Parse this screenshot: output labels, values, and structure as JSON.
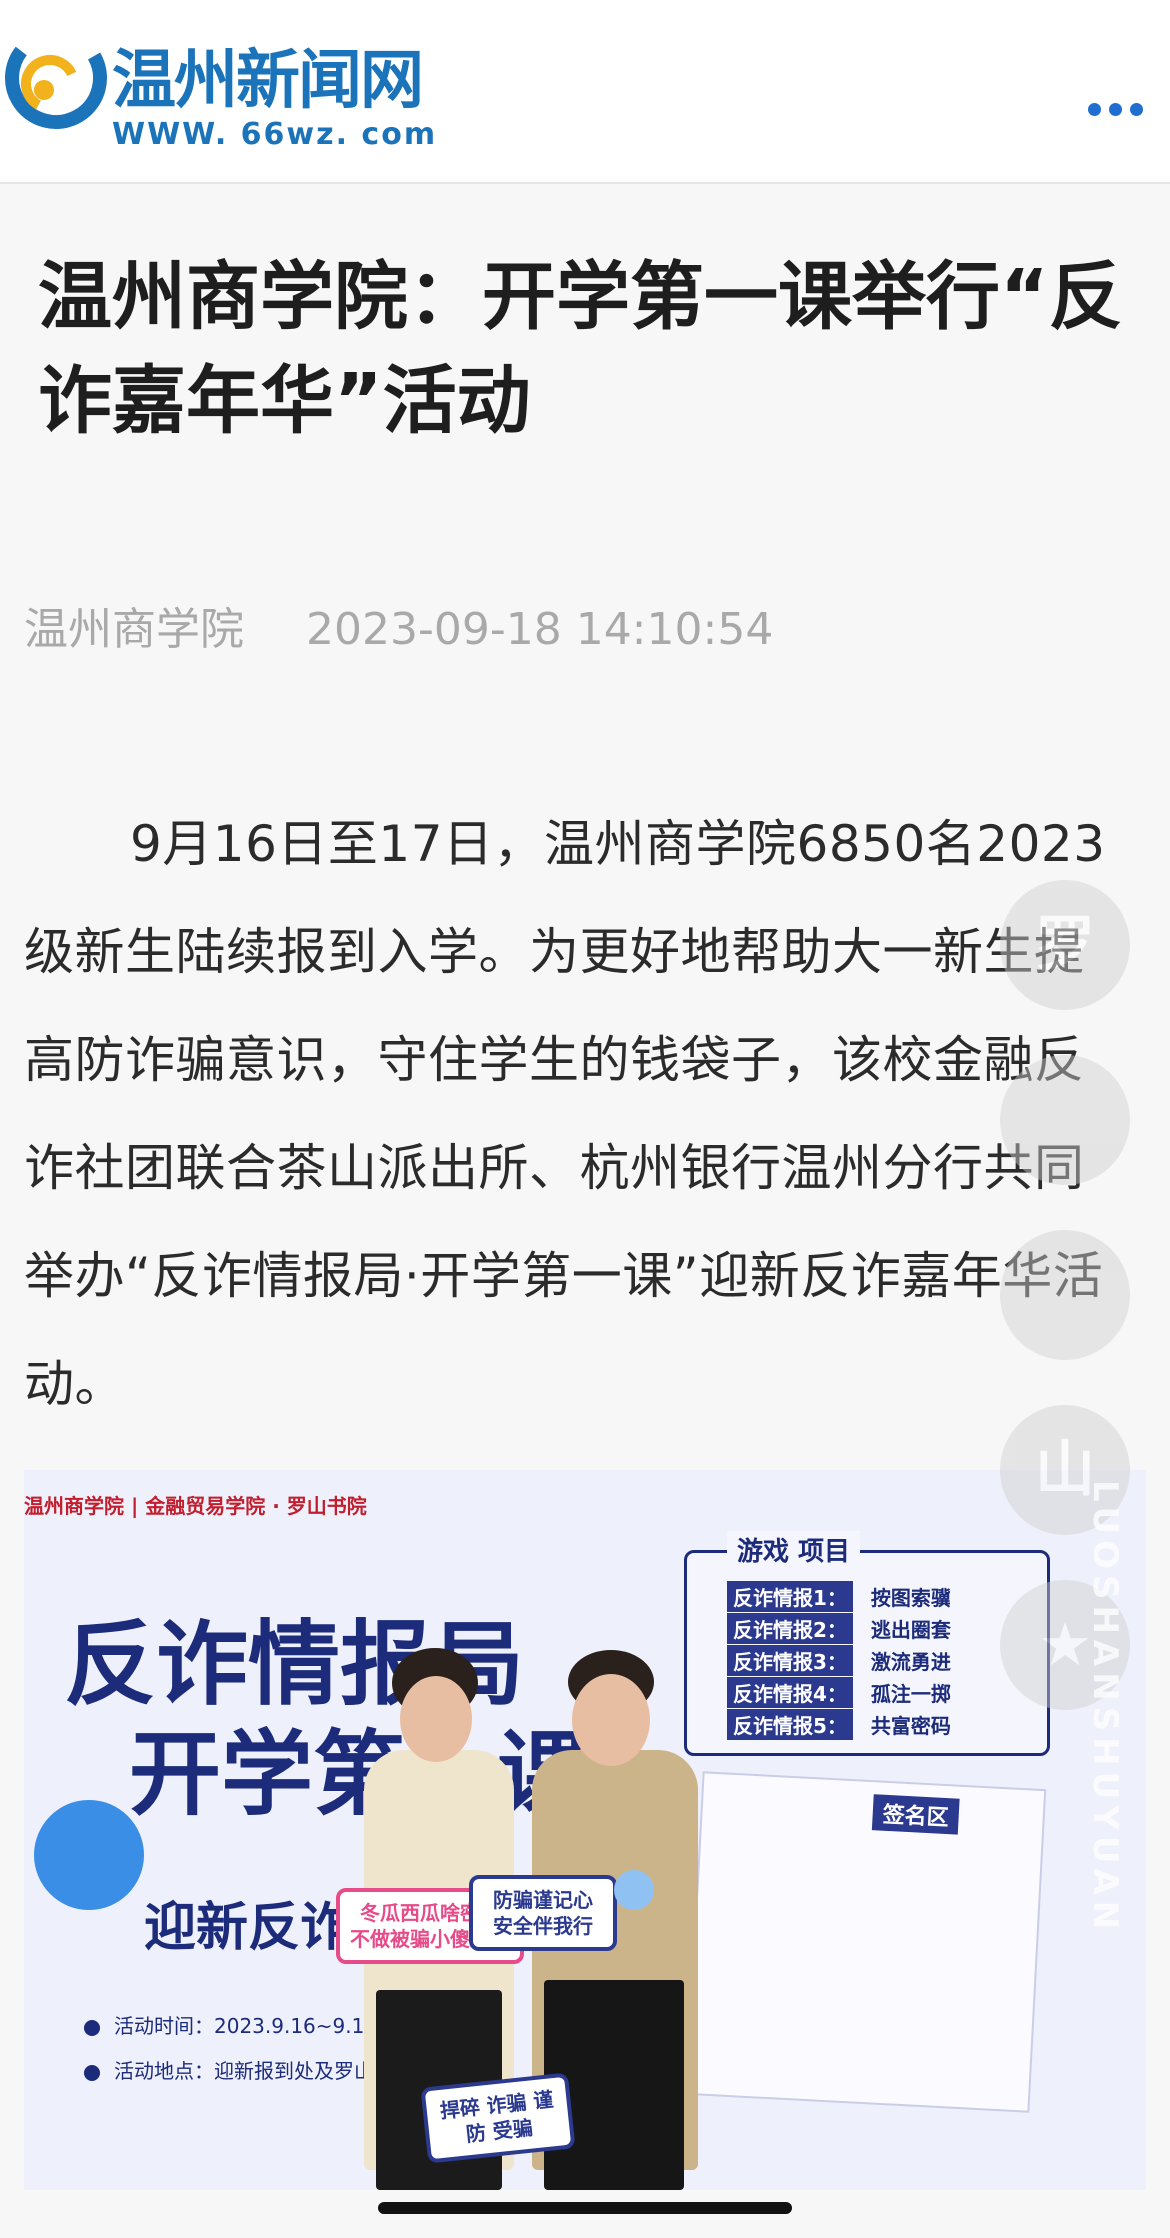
{
  "header": {
    "logo_text": "温州新闻网",
    "logo_url": "WWW. 66wz. com",
    "more_icon": "ellipsis-horizontal-icon"
  },
  "article": {
    "title": "温州商学院：开学第一课举行“反诈嘉年华”活动",
    "source": "温州商学院",
    "datetime": "2023-09-18 14:10:54",
    "paragraph": "9月16日至17日，温州商学院6850名2023级新生陆续报到入学。为更好地帮助大一新生提高防诈骗意识，守住学生的钱袋子，该校金融反诈社团联合茶山派出所、杭州银行温州分行共同举办“反诈情报局·开学第一课”迎新反诈嘉年华活动。"
  },
  "photo": {
    "header_text": "温州商学院 | 金融贸易学院 · 罗山书院",
    "poster_title_line1": "反诈情报局",
    "poster_title_line2": "开学第一课",
    "poster_subtitle": "迎新反诈嘉年华",
    "info": [
      "活动时间：2023.9.16~9.17",
      "活动地点：迎新报到处及罗山书院广场"
    ],
    "games_title": "游戏 项目",
    "games": [
      {
        "tag": "反诈情报1：",
        "name": "按图索骥"
      },
      {
        "tag": "反诈情报2：",
        "name": "逃出圈套"
      },
      {
        "tag": "反诈情报3：",
        "name": "激流勇进"
      },
      {
        "tag": "反诈情报4：",
        "name": "孤注一掷"
      },
      {
        "tag": "反诈情报5：",
        "name": "共富密码"
      }
    ],
    "sign_left": "冬瓜西瓜啥密瓜 不做被骗小傻瓜！",
    "sign_right": "防骗谨记心 安全伴我行",
    "sign_bottom": "捍碎 诈骗 谨防 受骗",
    "board_label": "签名区"
  },
  "watermark": {
    "letters": "LUOSHANSHUYUAN",
    "glyph_1": "罗",
    "glyph_4": "山"
  },
  "colors": {
    "brand_blue": "#1b73b9",
    "more_icon": "#1f6fd1",
    "title": "#1e1e1e",
    "meta": "#a9a9a9",
    "poster_navy": "#1c2b7a"
  }
}
